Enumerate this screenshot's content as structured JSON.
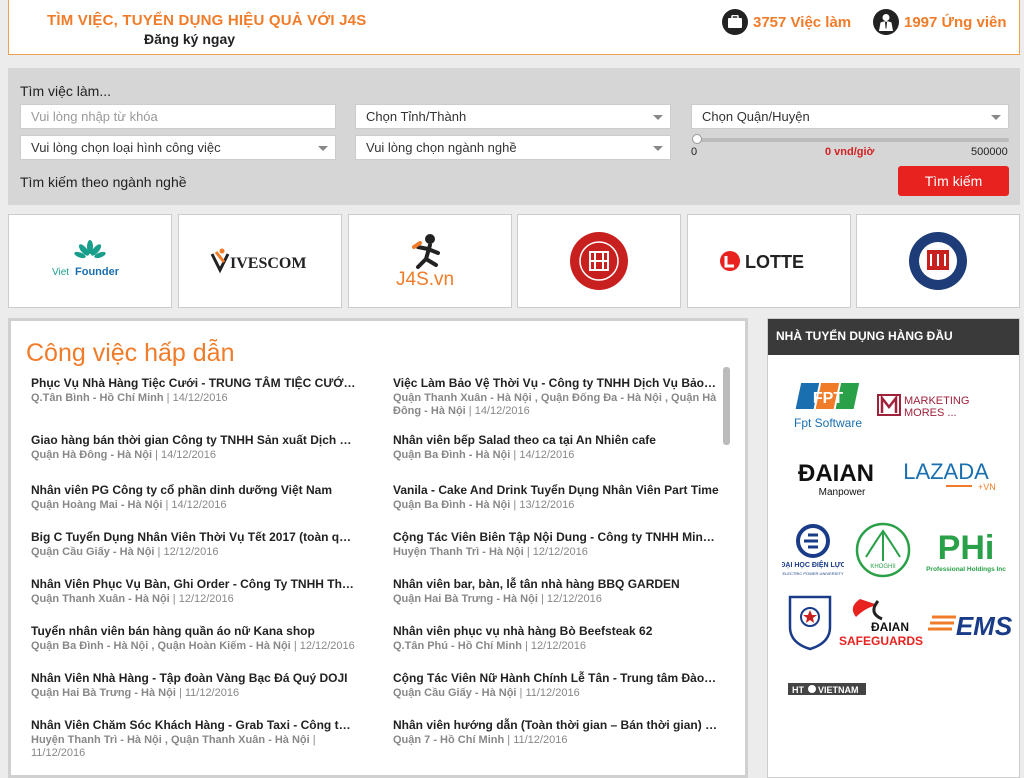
{
  "header": {
    "slogan": "TÌM VIỆC, TUYỂN DỤNG HIỆU QUẢ VỚI J4S",
    "signup": "Đăng ký ngay",
    "jobs_count": "3757 Việc làm",
    "candidates_count": "1997 Ứng viên"
  },
  "search": {
    "title": "Tìm việc làm...",
    "keyword_placeholder": "Vui lòng nhập từ khóa",
    "province": "Chọn Tỉnh/Thành",
    "district": "Chọn Quận/Huyện",
    "job_type": "Vui lòng chọn loại hình công việc",
    "industry": "Vui lòng chọn ngành nghề",
    "salary_min": "0",
    "salary_current": "0 vnd/giờ",
    "salary_max": "500000",
    "by_industry": "Tìm kiếm theo ngành nghề",
    "button": "Tìm kiếm"
  },
  "partners": {
    "vietfounder_a": "Viet",
    "vietfounder_b": "Founder",
    "vivescom": "IVESCOM",
    "j4s": "J4S.vn",
    "lotte": "LOTTE"
  },
  "jobs": {
    "heading": "Công việc hấp dẫn",
    "left": [
      {
        "title": "Phục Vụ Nhà Hàng Tiệc Cưới - TRUNG TÂM TIỆC CƯỚI VÀ HỘI NGHỊ",
        "loc": "Q.Tân Bình - Hồ Chí Minh",
        "date": "| 14/12/2016"
      },
      {
        "title": "Giao hàng bán thời gian Công ty TNHH Sản xuất Dịch vụ và Thương mại",
        "loc": "Quận Hà Đông - Hà Nội",
        "date": "| 14/12/2016"
      },
      {
        "title": "Nhân viên PG Công ty cổ phần dinh dưỡng Việt Nam",
        "loc": "Quận Hoàng Mai - Hà Nội",
        "date": "| 14/12/2016"
      },
      {
        "title": "Big C Tuyển Dụng Nhân Viên Thời Vụ Tết 2017 (toàn quốc)",
        "loc": "Quận Cầu Giấy - Hà Nội",
        "date": "| 12/12/2016"
      },
      {
        "title": "Nhân Viên Phục Vụ Bàn, Ghi Order - Công Ty TNHH Thương Mại",
        "loc": "Quận Thanh Xuân - Hà Nội",
        "date": "| 12/12/2016"
      },
      {
        "title": "Tuyển nhân viên bán hàng quần áo nữ Kana shop",
        "loc": "Quận Ba Đình - Hà Nội , Quận Hoàn Kiếm - Hà Nội",
        "date": "| 12/12/2016"
      },
      {
        "title": "Nhân Viên Nhà Hàng - Tập đoàn Vàng Bạc Đá Quý DOJI",
        "loc": "Quận Hai Bà Trưng - Hà Nội",
        "date": "| 11/12/2016"
      },
      {
        "title": "Nhân Viên Chăm Sóc Khách Hàng - Grab Taxi - Công ty TNHH Grab",
        "loc": "Huyện Thanh Trì - Hà Nội , Quận Thanh Xuân - Hà Nội",
        "date": "| 11/12/2016"
      }
    ],
    "right": [
      {
        "title": "Việc Làm Bảo Vệ Thời Vụ - Công ty TNHH Dịch Vụ Bảo Vệ Long Hải",
        "loc": "Quận Thanh Xuân - Hà Nội , Quận Đống Đa - Hà Nội , Quận Hà Đông - Hà Nội",
        "date": "| 14/12/2016"
      },
      {
        "title": "Nhân viên bếp Salad theo ca tại An Nhiên cafe",
        "loc": "Quận Ba Đình - Hà Nội",
        "date": "| 14/12/2016"
      },
      {
        "title": "Vanila - Cake And Drink Tuyển Dụng Nhân Viên Part Time",
        "loc": "Quận Ba Đình - Hà Nội",
        "date": "| 13/12/2016"
      },
      {
        "title": "Cộng Tác Viên Biên Tập Nội Dung - Công ty TNHH Minh Phúc Media",
        "loc": "Huyện Thanh Trì - Hà Nội",
        "date": "| 12/12/2016"
      },
      {
        "title": "Nhân viên bar, bàn, lễ tân nhà hàng BBQ GARDEN",
        "loc": "Quận Hai Bà Trưng - Hà Nội",
        "date": "| 12/12/2016"
      },
      {
        "title": "Nhân viên phục vụ nhà hàng Bò Beefsteak 62",
        "loc": "Q.Tân Phú - Hồ Chí Minh",
        "date": "| 12/12/2016"
      },
      {
        "title": "Cộng Tác Viên Nữ Hành Chính Lễ Tân - Trung tâm Đào tạo Công nghệ",
        "loc": "Quận Cầu Giấy - Hà Nội",
        "date": "| 11/12/2016"
      },
      {
        "title": "Nhân viên hướng dẫn (Toàn thời gian – Bán thời gian) Công ty Cổ phần",
        "loc": "Quận 7 - Hồ Chí Minh",
        "date": "| 11/12/2016"
      }
    ]
  },
  "employers": {
    "heading": "NHÀ TUYỂN DỤNG HÀNG ĐẦU",
    "fpt": "FPT",
    "fpt_sub": "Fpt Software",
    "mm_a": "MARKETING",
    "mm_b": "MORES ...",
    "daian": "ĐAIAN",
    "daian_sub": "Manpower",
    "lazada": "LAZADA",
    "lazada_sub": "+VN",
    "dhdl": "ĐẠI HỌC ĐIỆN LỰC",
    "dhdl_sub": "ELECTRIC POWER UNIVERSITY",
    "khoghii": "KHOGHII",
    "phi": "PHi",
    "phi_sub": "Professional Holdings Inc",
    "safeguards_a": "ĐAIAN",
    "safeguards_b": "SAFEGUARDS",
    "ems": "EMS",
    "htv_a": "HT",
    "htv_b": "VIETNAM"
  },
  "colors": {
    "accent": "#f07c2a",
    "button": "#e8221f",
    "dark": "#3a3a3a"
  }
}
